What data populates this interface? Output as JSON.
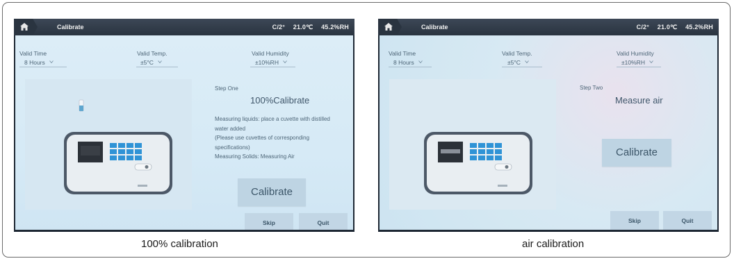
{
  "panels": [
    {
      "title": "Calibrate",
      "status": {
        "mode": "C/2°",
        "temperature": "21.0℃",
        "humidity": "45.2%RH"
      },
      "valid_time": {
        "label": "Valid Time",
        "value": "8 Hours"
      },
      "valid_temp": {
        "label": "Valid Temp.",
        "value": "±5°C"
      },
      "valid_humidity": {
        "label": "Valid Humidity",
        "value": "±10%RH"
      },
      "step_label": "Step One",
      "step_title": "100%Calibrate",
      "description": [
        "Measuring liquids: place a cuvette with distilled",
        "water added",
        "(Please use cuvettes of corresponding",
        "specifications)",
        "Measuring Solids: Measuring Air"
      ],
      "calibrate_label": "Calibrate",
      "skip_label": "Skip",
      "quit_label": "Quit",
      "caption": "100% calibration"
    },
    {
      "title": "Calibrate",
      "status": {
        "mode": "C/2°",
        "temperature": "21.0℃",
        "humidity": "45.2%RH"
      },
      "valid_time": {
        "label": "Valid Time",
        "value": "8 Hours"
      },
      "valid_temp": {
        "label": "Valid Temp.",
        "value": "±5°C"
      },
      "valid_humidity": {
        "label": "Valid Humidity",
        "value": "±10%RH"
      },
      "step_label": "Step Two",
      "step_title": "Measure air",
      "calibrate_label": "Calibrate",
      "skip_label": "Skip",
      "quit_label": "Quit",
      "caption": "air calibration"
    }
  ],
  "colors": {
    "titlebar": "#2a3440",
    "screen_bg": "#d8ebf6",
    "button": "#c2d6e5",
    "text": "#4d6577"
  },
  "icons": [
    "home-icon",
    "chevron-down-icon"
  ]
}
